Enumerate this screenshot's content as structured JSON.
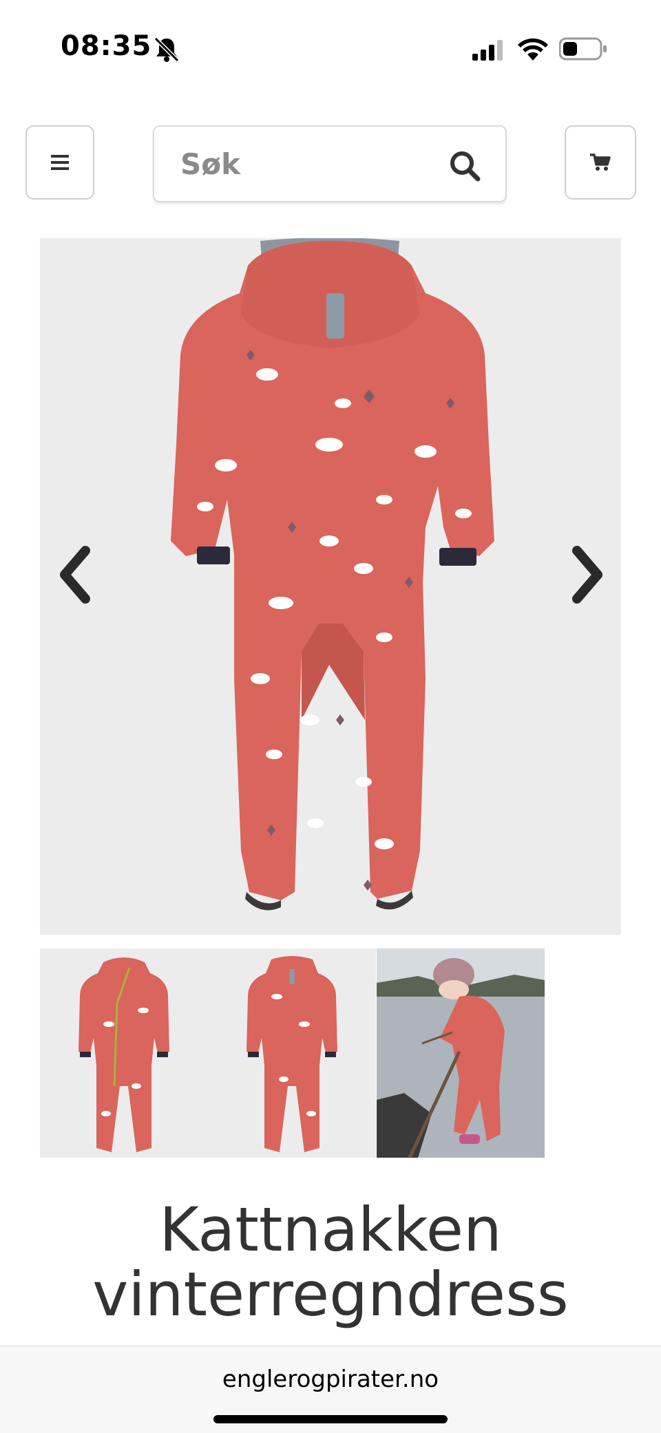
{
  "status_bar": {
    "time": "08:35",
    "icons": [
      "bell-slash-icon",
      "cellular-signal-icon",
      "wifi-icon",
      "battery-icon"
    ]
  },
  "header": {
    "menu_icon": "hamburger-icon",
    "search_placeholder": "Søk",
    "search_icon": "search-icon",
    "cart_icon": "cart-icon"
  },
  "gallery": {
    "main_image": "product-image-back",
    "prev_icon": "chevron-left-icon",
    "next_icon": "chevron-right-icon",
    "thumbnails": [
      "thumbnail-front",
      "thumbnail-back",
      "thumbnail-child-wearing"
    ]
  },
  "product": {
    "title_line1": "Kattnakken",
    "title_line2": "vinterregndress"
  },
  "browser": {
    "url": "englerogpirater.no"
  },
  "colors": {
    "suit": "#d9655c",
    "suit_dark": "#b9483f",
    "cuff": "#2a2a3a",
    "reflector": "#8e9aa6",
    "cloud": "#ffffff"
  }
}
